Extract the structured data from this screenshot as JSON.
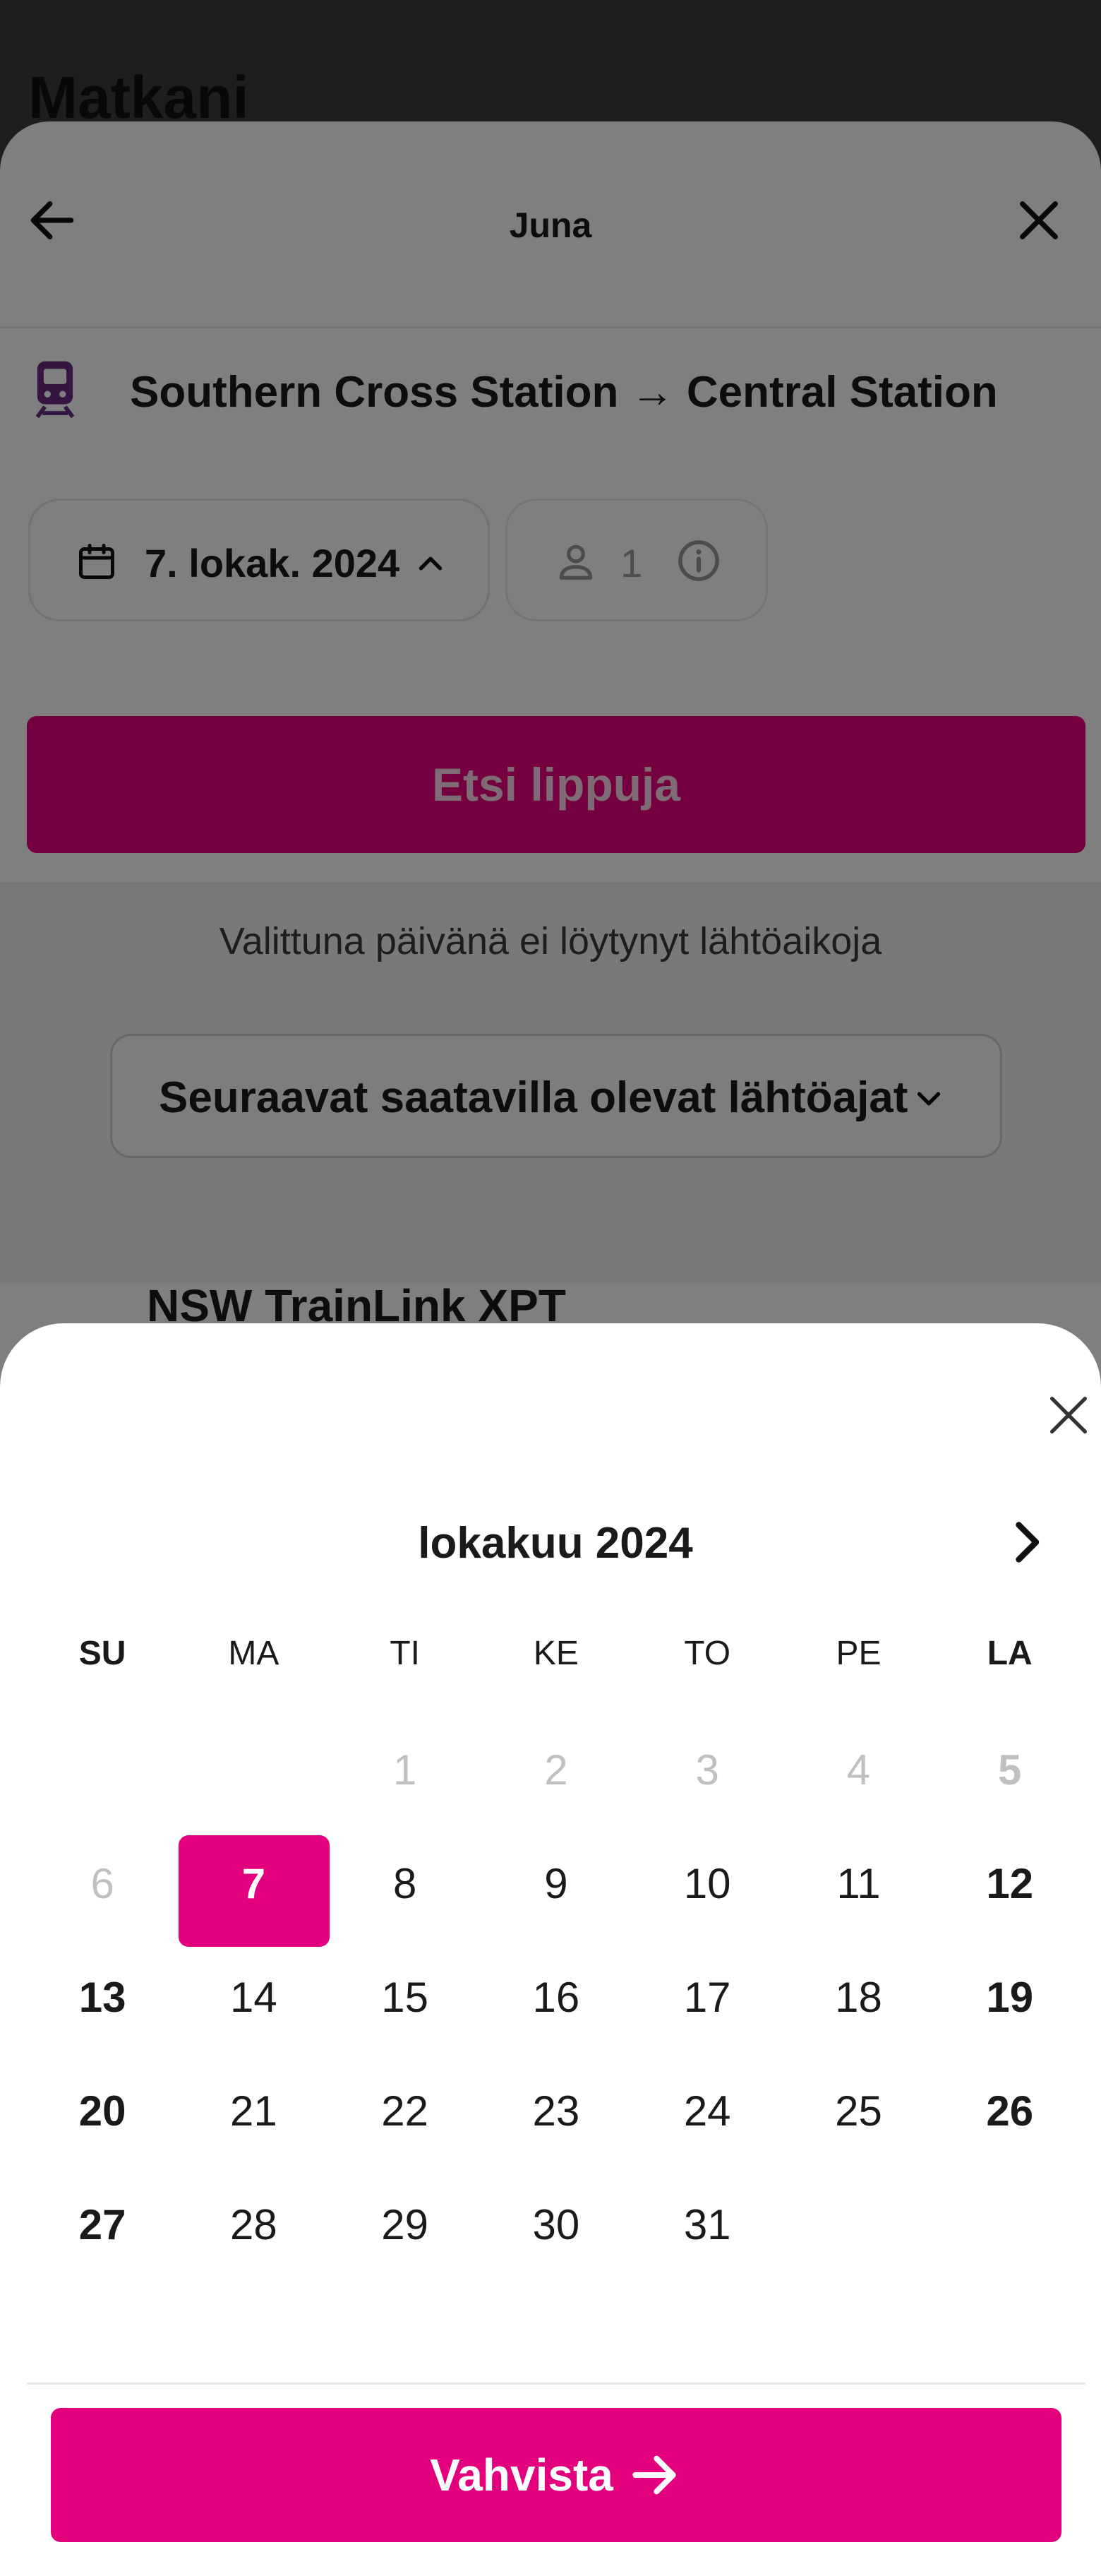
{
  "background": {
    "page_title": "Matkani"
  },
  "sheet": {
    "title": "Juna",
    "route": "Southern Cross Station → Central Station",
    "date_chip": "7. lokak. 2024",
    "passengers": "1",
    "search_button": "Etsi lippuja",
    "no_departures": "Valittuna päivänä ei löytynyt lähtöaikoja",
    "next_departures_button": "Seuraavat saatavilla olevat lähtöajat",
    "operator": "NSW TrainLink XPT"
  },
  "calendar": {
    "month": "lokakuu 2024",
    "weekdays": [
      "SU",
      "MA",
      "TI",
      "KE",
      "TO",
      "PE",
      "LA"
    ],
    "days": [
      {
        "d": "",
        "s": "empty"
      },
      {
        "d": "",
        "s": "empty"
      },
      {
        "d": "1",
        "s": "disabled"
      },
      {
        "d": "2",
        "s": "disabled"
      },
      {
        "d": "3",
        "s": "disabled"
      },
      {
        "d": "4",
        "s": "disabled"
      },
      {
        "d": "5",
        "s": "disabled-we"
      },
      {
        "d": "6",
        "s": "disabled"
      },
      {
        "d": "7",
        "s": "selected"
      },
      {
        "d": "8",
        "s": ""
      },
      {
        "d": "9",
        "s": ""
      },
      {
        "d": "10",
        "s": ""
      },
      {
        "d": "11",
        "s": ""
      },
      {
        "d": "12",
        "s": "we"
      },
      {
        "d": "13",
        "s": "we"
      },
      {
        "d": "14",
        "s": ""
      },
      {
        "d": "15",
        "s": ""
      },
      {
        "d": "16",
        "s": ""
      },
      {
        "d": "17",
        "s": ""
      },
      {
        "d": "18",
        "s": ""
      },
      {
        "d": "19",
        "s": "we"
      },
      {
        "d": "20",
        "s": "we"
      },
      {
        "d": "21",
        "s": ""
      },
      {
        "d": "22",
        "s": ""
      },
      {
        "d": "23",
        "s": ""
      },
      {
        "d": "24",
        "s": ""
      },
      {
        "d": "25",
        "s": ""
      },
      {
        "d": "26",
        "s": "we"
      },
      {
        "d": "27",
        "s": "we"
      },
      {
        "d": "28",
        "s": ""
      },
      {
        "d": "29",
        "s": ""
      },
      {
        "d": "30",
        "s": ""
      },
      {
        "d": "31",
        "s": ""
      }
    ],
    "confirm_button": "Vahvista"
  },
  "colors": {
    "accent": "#e2007c",
    "overlay": "rgba(0,0,0,0.5)"
  },
  "icons": [
    "back-icon",
    "close-icon",
    "train-icon",
    "calendar-icon",
    "chevron-up-icon",
    "person-icon",
    "info-icon",
    "chevron-down-icon",
    "chevron-right-icon",
    "arrow-right-icon"
  ]
}
